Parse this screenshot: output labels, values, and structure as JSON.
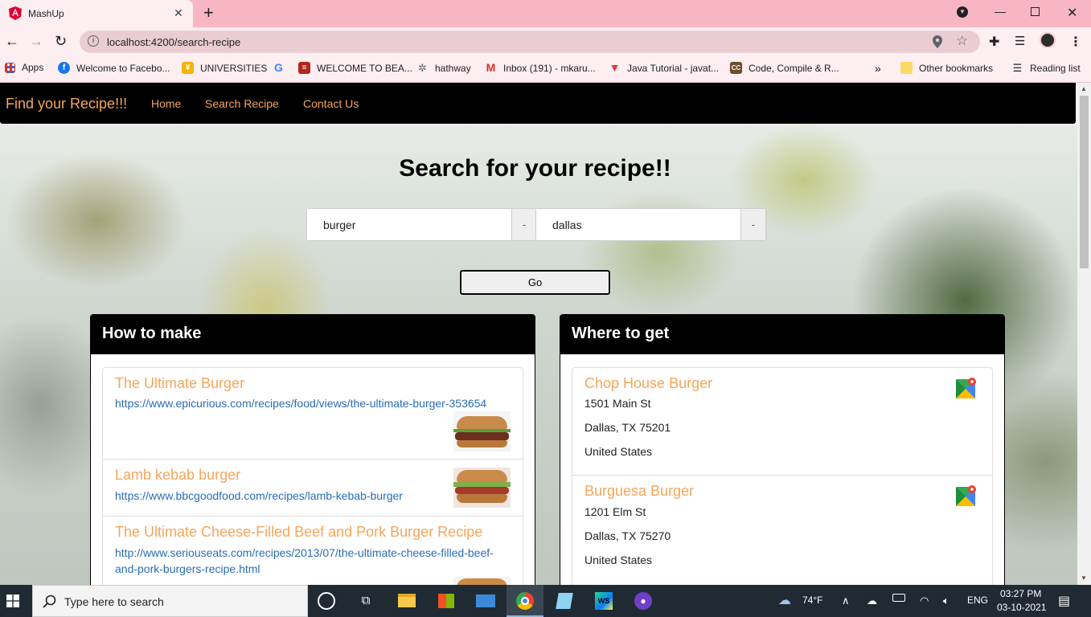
{
  "browser": {
    "tab_title": "MashUp",
    "url": "localhost:4200/search-recipe",
    "bookmarks": [
      {
        "label": "Apps"
      },
      {
        "label": "Welcome to Facebo..."
      },
      {
        "label": "UNIVERSITIES"
      },
      {
        "label": "WELCOME TO BEA..."
      },
      {
        "label": "hathway"
      },
      {
        "label": "Inbox (191) - mkaru..."
      },
      {
        "label": "Java Tutorial - javat..."
      },
      {
        "label": "Code, Compile & R..."
      },
      {
        "label": "Other bookmarks"
      },
      {
        "label": "Reading list"
      }
    ]
  },
  "nav": {
    "brand": "Find your Recipe!!!",
    "links": [
      "Home",
      "Search Recipe",
      "Contact Us"
    ]
  },
  "search": {
    "heading": "Search for your recipe!!",
    "query_value": "burger",
    "location_value": "dallas",
    "addon": "-",
    "go_label": "Go"
  },
  "how_to_make": {
    "title": "How to make",
    "items": [
      {
        "title": "The Ultimate Burger",
        "url": "https://www.epicurious.com/recipes/food/views/the-ultimate-burger-353654"
      },
      {
        "title": "Lamb kebab burger",
        "url": "https://www.bbcgoodfood.com/recipes/lamb-kebab-burger"
      },
      {
        "title": "The Ultimate Cheese-Filled Beef and Pork Burger Recipe",
        "url_line1": "http://www.seriouseats.com/recipes/2013/07/the-ultimate-cheese-filled-beef-",
        "url_line2": "and-pork-burgers-recipe.html"
      }
    ]
  },
  "where_to_get": {
    "title": "Where to get",
    "places": [
      {
        "name": "Chop House Burger",
        "street": "1501 Main St",
        "city": "Dallas, TX 75201",
        "country": "United States"
      },
      {
        "name": "Burguesa Burger",
        "street": "1201 Elm St",
        "city": "Dallas, TX 75270",
        "country": "United States"
      }
    ]
  },
  "taskbar": {
    "search_placeholder": "Type here to search",
    "weather": "74°F",
    "language": "ENG",
    "time": "03:27 PM",
    "date": "03-10-2021"
  },
  "colors": {
    "accent": "#f5a65b",
    "link": "#2a6cb8",
    "tabstrip": "#f8b6c2"
  }
}
